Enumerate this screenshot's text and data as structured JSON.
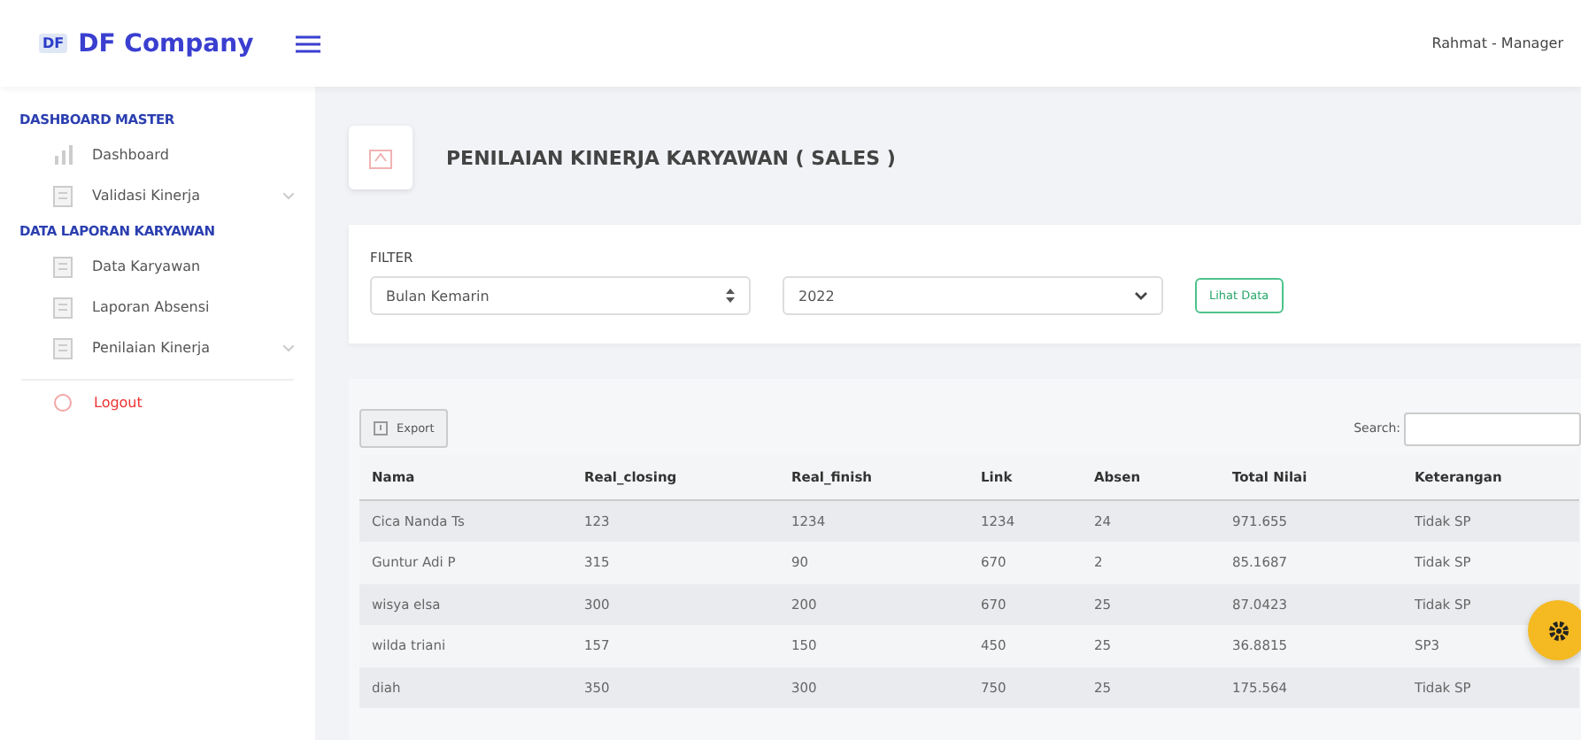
{
  "brand": {
    "logo": "DF",
    "name": "DF Company"
  },
  "user": "Rahmat - Manager",
  "sidebar": [
    {
      "kind": "heading",
      "label": "DASHBOARD MASTER"
    },
    {
      "kind": "item",
      "label": "Dashboard",
      "expandable": false
    },
    {
      "kind": "item",
      "label": "Validasi Kinerja",
      "expandable": true
    },
    {
      "kind": "heading",
      "label": "DATA LAPORAN KARYAWAN"
    },
    {
      "kind": "item",
      "label": "Data Karyawan",
      "expandable": false
    },
    {
      "kind": "item",
      "label": "Laporan Absensi",
      "expandable": false
    },
    {
      "kind": "item",
      "label": "Penilaian Kinerja",
      "expandable": true
    },
    {
      "kind": "logout",
      "label": "Logout"
    }
  ],
  "page_title": "PENILAIAN KINERJA KARYAWAN ( SALES )",
  "filter": {
    "label": "FILTER",
    "period": "Bulan Kemarin",
    "year": "2022",
    "button": "Lihat Data"
  },
  "export_button": "Export",
  "search_label": "Search:",
  "table": {
    "columns": [
      "Nama",
      "Real_closing",
      "Real_finish",
      "Link",
      "Absen",
      "Total Nilai",
      "Keterangan"
    ],
    "rows": [
      [
        "Cica Nanda Ts",
        "123",
        "1234",
        "1234",
        "24",
        "971.655",
        "Tidak SP"
      ],
      [
        "Guntur Adi P",
        "315",
        "90",
        "670",
        "2",
        "85.1687",
        "Tidak SP"
      ],
      [
        "wisya elsa",
        "300",
        "200",
        "670",
        "25",
        "87.0423",
        "Tidak SP"
      ],
      [
        "wilda triani",
        "157",
        "150",
        "450",
        "25",
        "36.8815",
        "SP3"
      ],
      [
        "diah",
        "350",
        "300",
        "750",
        "25",
        "175.564",
        "Tidak SP"
      ]
    ]
  }
}
